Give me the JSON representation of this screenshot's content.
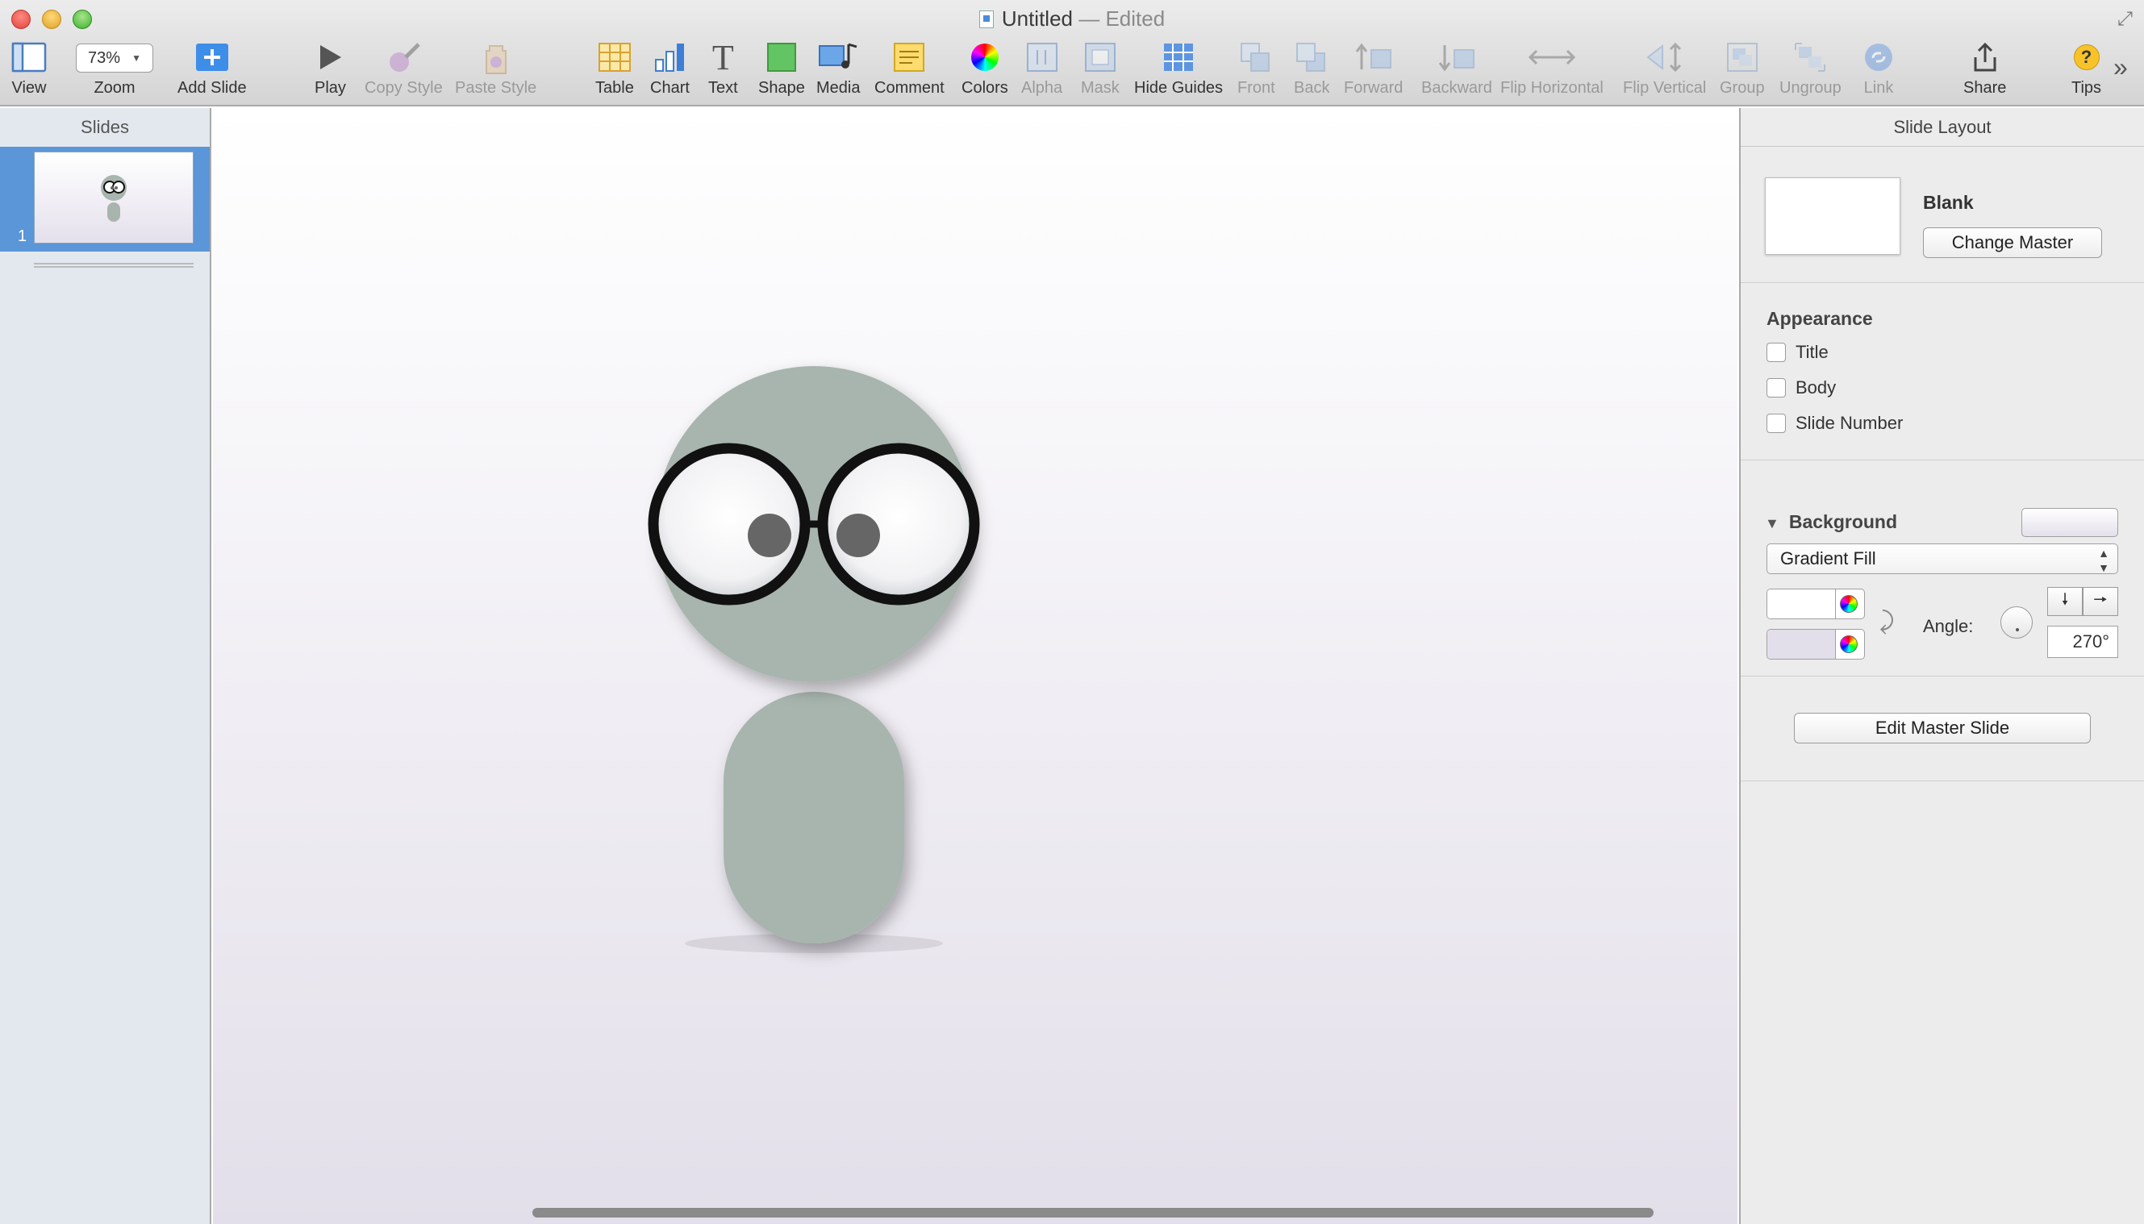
{
  "window": {
    "title": "Untitled",
    "status": "— Edited"
  },
  "toolbar": {
    "zoom_value": "73%",
    "items": [
      {
        "label": "View",
        "enabled": true
      },
      {
        "label": "Zoom",
        "enabled": true
      },
      {
        "label": "Add Slide",
        "enabled": true
      },
      {
        "label": "Play",
        "enabled": true
      },
      {
        "label": "Copy Style",
        "enabled": false
      },
      {
        "label": "Paste Style",
        "enabled": false
      },
      {
        "label": "Table",
        "enabled": true
      },
      {
        "label": "Chart",
        "enabled": true
      },
      {
        "label": "Text",
        "enabled": true
      },
      {
        "label": "Shape",
        "enabled": true
      },
      {
        "label": "Media",
        "enabled": true
      },
      {
        "label": "Comment",
        "enabled": true
      },
      {
        "label": "Colors",
        "enabled": true
      },
      {
        "label": "Alpha",
        "enabled": false
      },
      {
        "label": "Mask",
        "enabled": false
      },
      {
        "label": "Hide Guides",
        "enabled": true
      },
      {
        "label": "Front",
        "enabled": false
      },
      {
        "label": "Back",
        "enabled": false
      },
      {
        "label": "Forward",
        "enabled": false
      },
      {
        "label": "Backward",
        "enabled": false
      },
      {
        "label": "Flip Horizontal",
        "enabled": false
      },
      {
        "label": "Flip Vertical",
        "enabled": false
      },
      {
        "label": "Group",
        "enabled": false
      },
      {
        "label": "Ungroup",
        "enabled": false
      },
      {
        "label": "Link",
        "enabled": false
      },
      {
        "label": "Share",
        "enabled": true
      },
      {
        "label": "Tips",
        "enabled": true
      }
    ],
    "overflow_glyph": "»"
  },
  "slides_pane": {
    "header": "Slides",
    "slides": [
      {
        "number": "1",
        "selected": true
      }
    ]
  },
  "canvas": {
    "character": {
      "skin_color": "#a8b5ae",
      "pupil_color": "#666666",
      "frame_color": "#111111"
    },
    "background_top": "#ffffff",
    "background_bottom": "#e3dfea"
  },
  "inspector": {
    "header": "Slide Layout",
    "master": {
      "name": "Blank",
      "change_button": "Change Master"
    },
    "appearance": {
      "title": "Appearance",
      "options": [
        {
          "label": "Title",
          "checked": false
        },
        {
          "label": "Body",
          "checked": false
        },
        {
          "label": "Slide Number",
          "checked": false
        }
      ]
    },
    "background": {
      "title": "Background",
      "fill_type": "Gradient Fill",
      "color_top": "#ffffff",
      "color_bottom": "#e3dfea",
      "angle_label": "Angle:",
      "angle_value": "270°"
    },
    "edit_master_button": "Edit Master Slide"
  }
}
